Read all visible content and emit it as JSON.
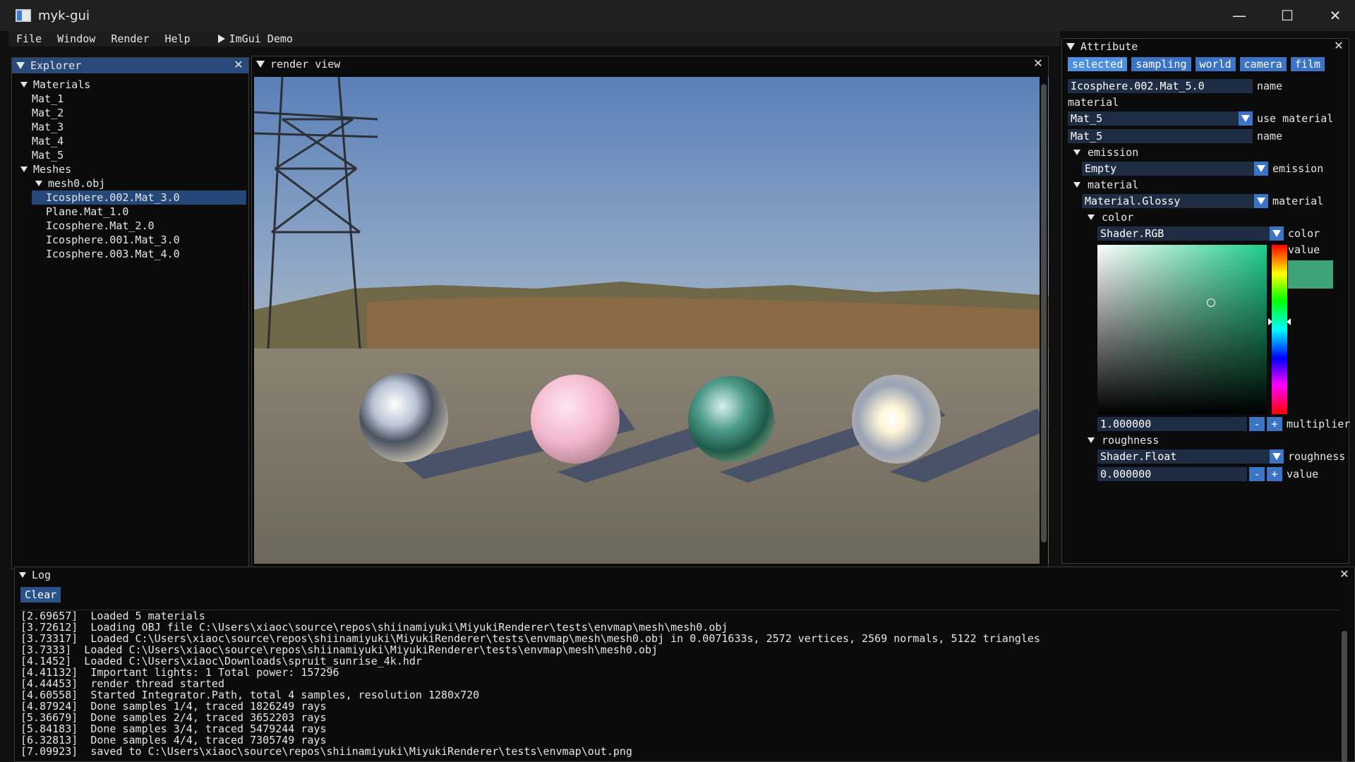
{
  "window": {
    "title": "myk-gui",
    "minimize_glyph": "—",
    "maximize_glyph": "☐",
    "close_glyph": "✕"
  },
  "menubar": {
    "items": [
      "File",
      "Window",
      "Render",
      "Help"
    ],
    "demo_label": "ImGui Demo"
  },
  "explorer": {
    "title": "Explorer",
    "materials_label": "Materials",
    "materials": [
      "Mat_1",
      "Mat_2",
      "Mat_3",
      "Mat_4",
      "Mat_5"
    ],
    "meshes_label": "Meshes",
    "mesh_file": "mesh0.obj",
    "mesh_items": [
      "Icosphere.002.Mat_3.0",
      "Plane.Mat_1.0",
      "Icosphere.Mat_2.0",
      "Icosphere.001.Mat_3.0",
      "Icosphere.003.Mat_4.0"
    ],
    "selected_index": 0
  },
  "render_view": {
    "title": "render view"
  },
  "attribute": {
    "title": "Attribute",
    "tabs": [
      "selected",
      "sampling",
      "world",
      "camera",
      "film"
    ],
    "active_tab": "selected",
    "object_name_value": "Icosphere.002.Mat_5.0",
    "object_name_label": "name",
    "material_section": "material",
    "use_material_value": "Mat_5",
    "use_material_label": "use material",
    "material_name_value": "Mat_5",
    "material_name_label": "name",
    "emission_header": "emission",
    "emission_value": "Empty",
    "emission_label": "emission",
    "material_header": "material",
    "material_value": "Material.Glossy",
    "material_label": "material",
    "color_header": "color",
    "color_shader_value": "Shader.RGB",
    "color_shader_label": "color",
    "color_value_label": "value",
    "color_swatch_hex": "#3fa378",
    "multiplier_value": "1.000000",
    "multiplier_label": "multiplier",
    "roughness_header": "roughness",
    "roughness_shader_value": "Shader.Float",
    "roughness_shader_label": "roughness",
    "roughness_value": "0.000000",
    "roughness_value_label": "value",
    "minus": "-",
    "plus": "+"
  },
  "log": {
    "title": "Log",
    "clear_label": "Clear",
    "lines": [
      "[2.69657]  Loaded 5 materials",
      "[3.72612]  Loading OBJ file C:\\Users\\xiaoc\\source\\repos\\shiinamiyuki\\MiyukiRenderer\\tests\\envmap\\mesh\\mesh0.obj",
      "[3.73317]  Loaded C:\\Users\\xiaoc\\source\\repos\\shiinamiyuki\\MiyukiRenderer\\tests\\envmap\\mesh\\mesh0.obj in 0.0071633s, 2572 vertices, 2569 normals, 5122 triangles",
      "[3.7333]  Loaded C:\\Users\\xiaoc\\source\\repos\\shiinamiyuki\\MiyukiRenderer\\tests\\envmap\\mesh\\mesh0.obj",
      "[4.1452]  Loaded C:\\Users\\xiaoc\\Downloads\\spruit_sunrise_4k.hdr",
      "[4.41132]  Important lights: 1 Total power: 157296",
      "[4.44453]  render thread started",
      "[4.60558]  Started Integrator.Path, total 4 samples, resolution 1280x720",
      "[4.87924]  Done samples 1/4, traced 1826249 rays",
      "[5.36679]  Done samples 2/4, traced 3652203 rays",
      "[5.84183]  Done samples 3/4, traced 5479244 rays",
      "[6.32813]  Done samples 4/4, traced 7305749 rays",
      "[7.09923]  saved to C:\\Users\\xiaoc\\source\\repos\\shiinamiyuki\\MiyukiRenderer\\tests\\envmap\\out.png"
    ]
  },
  "colors": {
    "accent": "#3b73c5",
    "header_active": "#294a7a",
    "selection": "#26477a"
  }
}
